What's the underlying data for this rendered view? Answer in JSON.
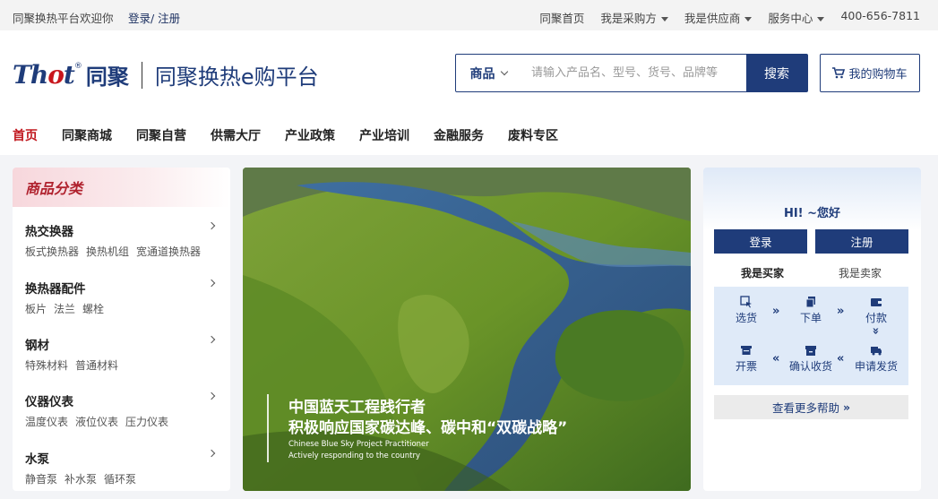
{
  "topbar": {
    "welcome": "同聚换热平台欢迎你",
    "login": "登录/ 注册",
    "links": [
      "同聚首页",
      "我是采购方",
      "我是供应商",
      "服务中心",
      "400-656-7811"
    ]
  },
  "header": {
    "logo_mark": "Thot",
    "logo_mark_o": "o",
    "logo_cn": "同聚",
    "title": "同聚换热e购平台",
    "search_category": "商品",
    "search_placeholder": "请输入产品名、型号、货号、品牌等",
    "search_button": "搜索",
    "cart_label": "我的购物车"
  },
  "nav": [
    "首页",
    "同聚商城",
    "同聚自营",
    "供需大厅",
    "产业政策",
    "产业培训",
    "金融服务",
    "废料专区"
  ],
  "categories": {
    "title": "商品分类",
    "items": [
      {
        "name": "热交换器",
        "subs": [
          "板式换热器",
          "换热机组",
          "宽通道换热器"
        ]
      },
      {
        "name": "换热器配件",
        "subs": [
          "板片",
          "法兰",
          "螺栓"
        ]
      },
      {
        "name": "钢材",
        "subs": [
          "特殊材料",
          "普通材料"
        ]
      },
      {
        "name": "仪器仪表",
        "subs": [
          "温度仪表",
          "液位仪表",
          "压力仪表"
        ]
      },
      {
        "name": "水泵",
        "subs": [
          "静音泵",
          "补水泵",
          "循环泵"
        ]
      }
    ]
  },
  "banner": {
    "line1": "中国蓝天工程践行者",
    "line2": "积极响应国家碳达峰、碳中和“双碳战略”",
    "line3": "Chinese Blue Sky Project Practitioner",
    "line4": "Actively responding to the country"
  },
  "user": {
    "greeting": "HI!  ~您好",
    "login": "登录",
    "register": "注册",
    "role_buyer": "我是买家",
    "role_seller": "我是卖家",
    "steps": [
      "选货",
      "下单",
      "付款",
      "开票",
      "确认收货",
      "申请发货"
    ],
    "help": "查看更多帮助"
  },
  "colors": {
    "brand": "#1f3c7a",
    "accent": "#c0161d"
  }
}
